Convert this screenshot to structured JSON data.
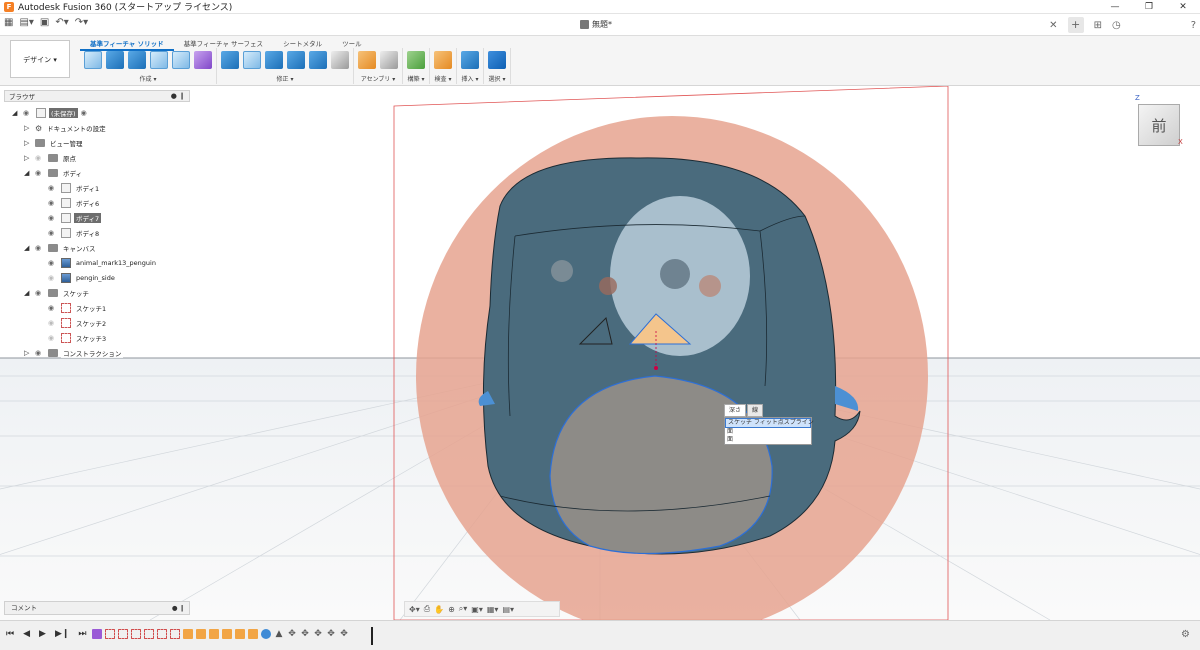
{
  "window": {
    "title": "Autodesk Fusion 360 (スタートアップ ライセンス)",
    "logo": "F",
    "document_tab": "無題*"
  },
  "ribbon": {
    "workspace_button": "デザイン ▾",
    "tabs": [
      "基準フィーチャ ソリッド",
      "基準フィーチャ サーフェス",
      "シートメタル",
      "ツール"
    ],
    "groups": [
      {
        "label": "作成 ▾"
      },
      {
        "label": "修正 ▾"
      },
      {
        "label": "アセンブリ ▾"
      },
      {
        "label": "構築 ▾"
      },
      {
        "label": "検査 ▾"
      },
      {
        "label": "挿入 ▾"
      },
      {
        "label": "選択 ▾"
      }
    ]
  },
  "browser": {
    "header": "ブラウザ",
    "items": [
      {
        "label": "(未保存)",
        "type": "root"
      },
      {
        "label": "ドキュメントの設定",
        "type": "gear"
      },
      {
        "label": "ビュー管理",
        "type": "folder"
      },
      {
        "label": "原点",
        "type": "folder"
      },
      {
        "label": "ボディ",
        "type": "folder"
      },
      {
        "label": "ボディ1",
        "type": "body"
      },
      {
        "label": "ボディ6",
        "type": "body"
      },
      {
        "label": "ボディ7",
        "type": "body",
        "selected": true
      },
      {
        "label": "ボディ8",
        "type": "body"
      },
      {
        "label": "キャンバス",
        "type": "folder"
      },
      {
        "label": "animal_mark13_penguin",
        "type": "canvas"
      },
      {
        "label": "pengin_side",
        "type": "canvas"
      },
      {
        "label": "スケッチ",
        "type": "folder"
      },
      {
        "label": "スケッチ1",
        "type": "sketch"
      },
      {
        "label": "スケッチ2",
        "type": "sketch"
      },
      {
        "label": "スケッチ3",
        "type": "sketch"
      },
      {
        "label": "コンストラクション",
        "type": "folder"
      }
    ]
  },
  "comment_bar": {
    "label": "コメント"
  },
  "viewcube": {
    "face": "前",
    "z_axis": "Z",
    "x_axis": "X"
  },
  "sketch_dialog": {
    "tabs": [
      "深さ",
      "線"
    ],
    "lines": [
      "スケッチ フィット点スプライン",
      "面",
      "面"
    ]
  },
  "colors": {
    "accent": "#0f6fc6",
    "canvas_red": "#e06a52",
    "body_blue": "#4a6b7d",
    "spline_blue": "#2d6fd6"
  },
  "icons": {
    "visibility": "eye-icon",
    "expand": "triangle-icon",
    "settings": "gear-icon"
  }
}
